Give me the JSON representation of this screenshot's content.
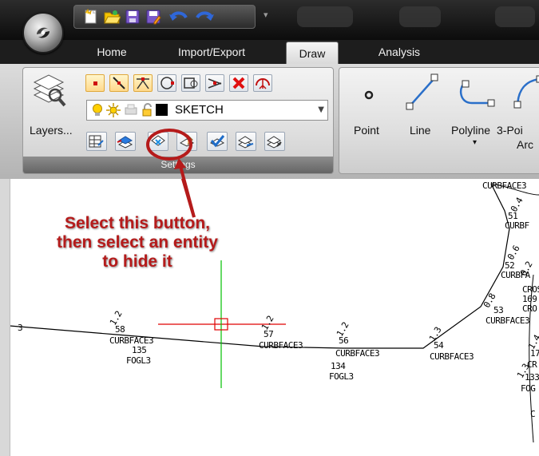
{
  "tabs": [
    {
      "label": "Home",
      "active": false
    },
    {
      "label": "Import/Export",
      "active": false
    },
    {
      "label": "Draw",
      "active": true
    },
    {
      "label": "Analysis",
      "active": false
    }
  ],
  "qat_more_glyph": "▾",
  "settings_group": {
    "label": "Settings",
    "layers_button": "Layers...",
    "current_layer": "SKETCH",
    "current_layer_color": "#000000"
  },
  "draw_group": {
    "buttons": [
      {
        "label": "Point"
      },
      {
        "label": "Line"
      },
      {
        "label": "Polyline",
        "sub": "▾"
      },
      {
        "label": "3-Poi",
        "sub": "Arc"
      }
    ]
  },
  "callout": {
    "lines": [
      "Select this button,",
      "then select an entity",
      "to hide it"
    ],
    "color": "#b51b1b"
  },
  "drawing": {
    "labels": [
      "CURBFACE3",
      "51",
      "CURBF",
      "52",
      "CURBFA",
      "CROS",
      "169",
      "CRO",
      "53",
      "CURBFACE3",
      "3",
      "58",
      "CURBFACE3",
      "135",
      "FOGL3",
      "57",
      "CURBFACE3",
      "56",
      "CURBFACE3",
      "134",
      "FOGL3",
      "54",
      "CURBFACE3",
      "17",
      "CR",
      "133",
      "FOG",
      "C"
    ],
    "point_ids": [
      "1.2",
      "0.4",
      "0.6",
      "0.2",
      "1.2",
      "1.2",
      "1.3",
      "1.4",
      "0.8",
      "1.3"
    ],
    "colors": {
      "crosshair_h": "#e00000",
      "crosshair_v": "#00c000",
      "lines": "#000000"
    }
  }
}
